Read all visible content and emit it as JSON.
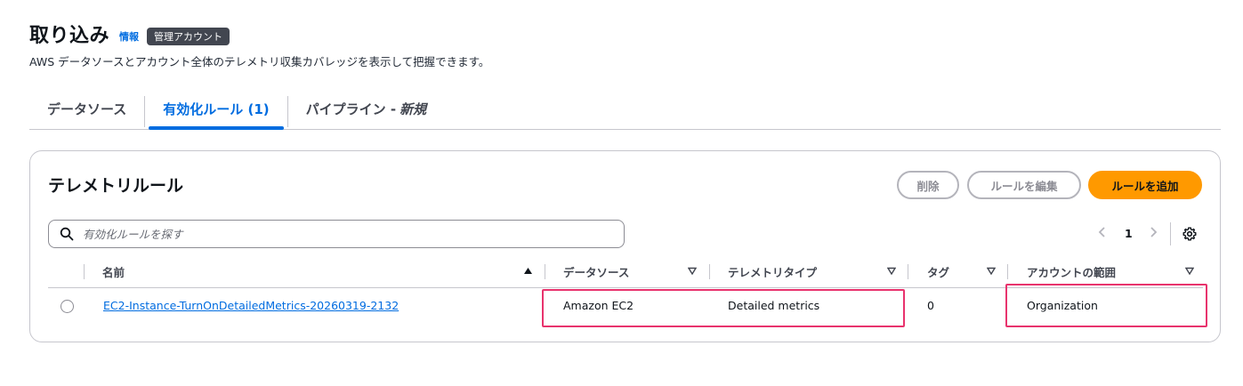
{
  "header": {
    "title": "取り込み",
    "info_link": "情報",
    "badge": "管理アカウント",
    "subtitle": "AWS データソースとアカウント全体のテレメトリ収集カバレッジを表示して把握できます。"
  },
  "tabs": [
    {
      "label": "データソース",
      "suffix": ""
    },
    {
      "label": "有効化ルール (1)",
      "suffix": ""
    },
    {
      "label": "パイプライン - ",
      "suffix": "新規"
    }
  ],
  "active_tab_index": 1,
  "card": {
    "title": "テレメトリルール",
    "buttons": {
      "delete": "削除",
      "edit": "ルールを編集",
      "add": "ルールを追加"
    },
    "search": {
      "placeholder": "有効化ルールを探す",
      "value": ""
    },
    "pagination": {
      "current_page": "1"
    },
    "columns": [
      "名前",
      "データソース",
      "テレメトリタイプ",
      "タグ",
      "アカウントの範囲"
    ],
    "sorted_column": "名前",
    "rows": [
      {
        "name": "EC2-Instance-TurnOnDetailedMetrics-20260319-2132",
        "data_source": "Amazon EC2",
        "telemetry_type": "Detailed metrics",
        "tags": "0",
        "account_scope": "Organization"
      }
    ]
  },
  "icons": [
    "search-icon",
    "chevron-left-icon",
    "chevron-right-icon",
    "gear-icon",
    "sort-ascending-icon",
    "sort-icon"
  ],
  "colors": {
    "accent": "#006ce0",
    "primary_button": "#ff9900",
    "highlight_box": "#e8336d",
    "badge_bg": "#424650"
  }
}
